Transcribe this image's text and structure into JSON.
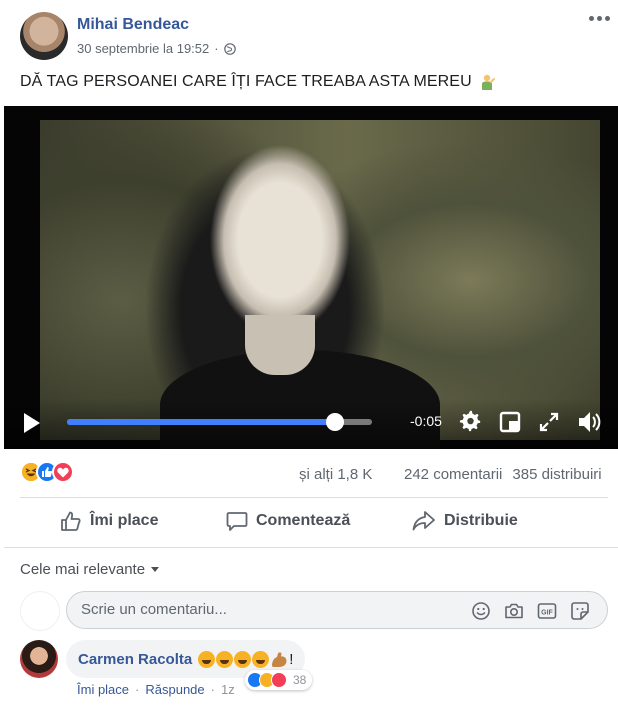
{
  "post": {
    "author": "Mihai Bendeac",
    "timestamp": "30 septembrie la 19:52",
    "separator": "·",
    "privacy_icon": "globe-icon",
    "caption": "DĂ TAG PERSOANEI CARE ÎȚI FACE TREABA ASTA MEREU",
    "caption_emoji": "person-gesturing-icon"
  },
  "video": {
    "time_remaining": "-0:05",
    "progress": 0.88,
    "controls": [
      "play-icon",
      "gear-icon",
      "pip-icon",
      "fullscreen-icon",
      "volume-icon"
    ]
  },
  "stats": {
    "reaction_icons": [
      "haha",
      "like",
      "love"
    ],
    "others": "și alți 1,8 K",
    "comments": "242 comentarii",
    "shares": "385 distribuiri"
  },
  "actions": {
    "like": "Îmi place",
    "comment": "Comentează",
    "share": "Distribuie"
  },
  "comments_section": {
    "sort_label": "Cele mai relevante",
    "input_placeholder": "Scrie un comentariu...",
    "input_icons": [
      "emoji-icon",
      "camera-icon",
      "gif-icon",
      "sticker-icon"
    ]
  },
  "comment": {
    "author": "Carmen Racolta",
    "text_suffix": "!",
    "emojis": [
      "laughing-emoji",
      "laughing-emoji",
      "laughing-emoji",
      "laughing-emoji",
      "flexed-biceps-emoji"
    ],
    "like_label": "Îmi place",
    "reply_label": "Răspunde",
    "separator": "·",
    "time": "1z",
    "reaction_count": "38"
  },
  "colors": {
    "link_blue": "#365899",
    "progress_blue": "#4080ff",
    "like_blue": "#1877f2",
    "love_red": "#f33e58",
    "haha_yellow": "#f7b125"
  }
}
